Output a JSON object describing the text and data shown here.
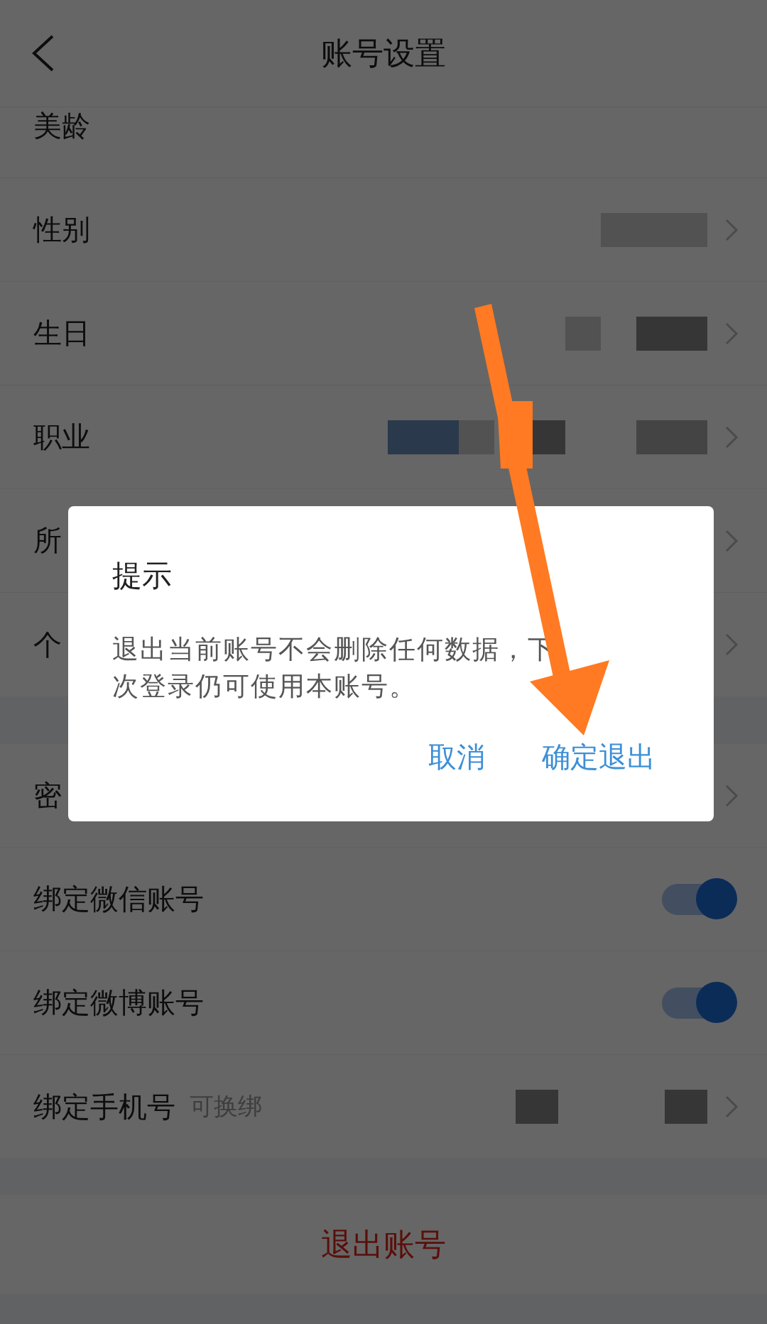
{
  "header": {
    "title": "账号设置"
  },
  "sections": [
    {
      "rows": [
        {
          "label": "美龄",
          "kind": "plain"
        },
        {
          "label": "性别",
          "kind": "link",
          "value_redacted": true
        },
        {
          "label": "生日",
          "kind": "link",
          "value_redacted": true
        },
        {
          "label": "职业",
          "kind": "link",
          "value_redacted": true
        },
        {
          "label": "所",
          "kind": "link"
        },
        {
          "label": "个",
          "kind": "link"
        }
      ]
    },
    {
      "rows": [
        {
          "label": "密",
          "kind": "link"
        },
        {
          "label": "绑定微信账号",
          "kind": "toggle",
          "on": true
        },
        {
          "label": "绑定微博账号",
          "kind": "toggle",
          "on": true
        },
        {
          "label": "绑定手机号",
          "note": "可换绑",
          "kind": "link",
          "value_redacted": true
        }
      ]
    }
  ],
  "logout_button": {
    "label": "退出账号"
  },
  "dialog": {
    "title": "提示",
    "message": "退出当前账号不会删除任何数据，下次登录仍可使用本账号。",
    "buttons": [
      {
        "label": "取消"
      },
      {
        "label": "确定退出"
      }
    ]
  }
}
